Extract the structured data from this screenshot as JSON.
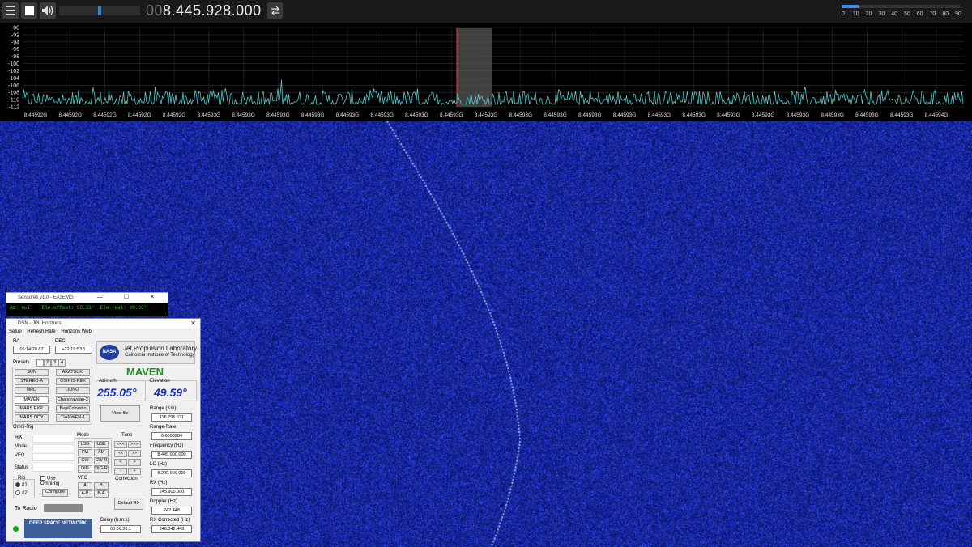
{
  "toolbar": {
    "frequency_prefix": "00",
    "frequency_main": "8.445.928.000",
    "volume_level": 0.5,
    "smeter_ticks": [
      "0",
      "10",
      "20",
      "30",
      "40",
      "50",
      "60",
      "70",
      "80",
      "90"
    ],
    "smeter_level": 13,
    "icons": {
      "menu": "hamburger-icon",
      "stop": "stop-icon",
      "volume": "speaker-icon",
      "swap": "swap-arrows-icon"
    }
  },
  "spectrum": {
    "y_ticks": [
      "-90",
      "-92",
      "-94",
      "-96",
      "-98",
      "-100",
      "-102",
      "-104",
      "-106",
      "-108",
      "-110",
      "-112"
    ],
    "x_ticks": [
      "8.44592G",
      "8.44592G",
      "8.44592G",
      "8.44592G",
      "8.44592G",
      "8.44593G",
      "8.44593G",
      "8.44593G",
      "8.44593G",
      "8.44593G",
      "8.44593G",
      "8.44593G",
      "8.44593G",
      "8.44593G",
      "8.44593G",
      "8.44593G",
      "8.44593G",
      "8.44593G",
      "8.44593G",
      "8.44593G",
      "8.44593G",
      "8.44593G",
      "8.44593G",
      "8.44593G",
      "8.44593G",
      "8.44593G",
      "8.44594G"
    ],
    "trace_color": "#5ec8c8",
    "passband_color": "#555555",
    "marker_color": "#ff3030"
  },
  "waterfall": {
    "background_color": "#12208c",
    "signal_color": "#bfd4ff"
  },
  "small_window": {
    "title": "Sensores v1.0 - EA3EMG",
    "readout": "Az: null   Ele.offset: 50.33°  Ele.real: 20.33°"
  },
  "dsn": {
    "title": "DSN - JPL Horizons",
    "menu": [
      "Setup",
      "Refresh Rate",
      "Horizons Web"
    ],
    "ra_label": "RA",
    "ra_value": "05:14:28.87",
    "dec_label": "DEC",
    "dec_value": "+22:19:53.1",
    "presets_label": "Presets",
    "preset_pages": [
      "1",
      "2",
      "3",
      "4"
    ],
    "preset_buttons": [
      "SUN",
      "AKATSUKI",
      "STEREO-A",
      "OSIRIS-REX",
      "MRO",
      "JUNO",
      "MAVEN",
      "Chandrayaan-2",
      "MARS EXP.",
      "BepiColombo",
      "MARS ODY",
      "TIANWEN-1"
    ],
    "jpl_title": "Jet Propulsion Laboratory",
    "jpl_subtitle": "California Institute of Technology",
    "nasa_logo_text": "NASA",
    "target": "MAVEN",
    "azimuth_label": "Azimuth",
    "azimuth_value": "255.05°",
    "elevation_label": "Elevation",
    "elevation_value": "49.59°",
    "viewfile_button": "View file",
    "range_label": "Range (Km)",
    "range_value": "116.795.631",
    "range_rate_label": "Range-Rate",
    "range_rate_value": "6.6098284",
    "frequency_label": "Frequency (Hz)",
    "frequency_value": "8.445.900.000",
    "lo_label": "LO (Hz)",
    "lo_value": "8.200.000.000",
    "rx_label": "RX (Hz)",
    "rx_value": "245.900.000",
    "doppler_label": "Doppler (Hz)",
    "doppler_value": "242.448",
    "rx_corrected_label": "RX Corrected (Hz)",
    "rx_corrected_value": "246.042.448",
    "delay_label": "Delay (h:m:s)",
    "delay_value": "00:06:36.1",
    "omnirig_label": "Omni-Rig",
    "rx_field_label": "RX",
    "mode_field_label": "Mode",
    "vfo_field_label": "VFO",
    "status_field_label": "Status",
    "mode_label": "Mode",
    "mode_buttons": [
      "LSB",
      "USB",
      "FM",
      "AM",
      "CW",
      "CW-R",
      "DIG",
      "DIG-R"
    ],
    "tune_label": "Tune",
    "tune_buttons": [
      "<<<",
      ">>>",
      "<<",
      ">>",
      "<",
      ">",
      "-",
      "+"
    ],
    "rig_label": "Rig",
    "rig1": "#1",
    "rig2": "#2",
    "use_omnirig": "Use OmniRig",
    "configure_button": "Configure",
    "vfo_label": "VFO",
    "vfo_buttons": [
      "A",
      "B",
      "A-B",
      "B-A"
    ],
    "correction_label": "Correction",
    "default_rx_button": "Default RX",
    "to_radio_label": "To Radio",
    "dsn_logo_text": "DEEP SPACE NETWORK"
  }
}
